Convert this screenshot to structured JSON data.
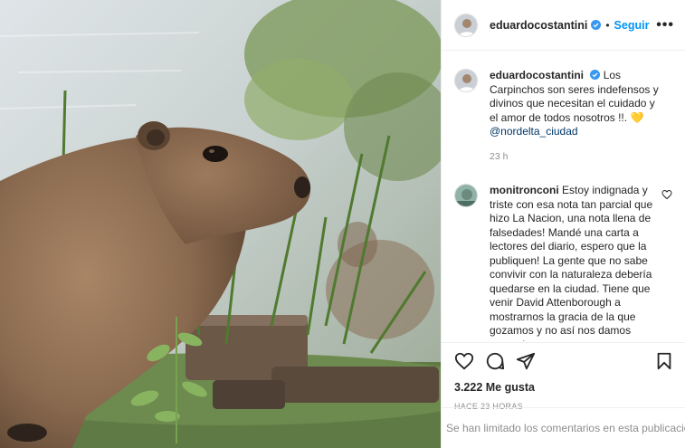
{
  "post": {
    "photo_icon": "capybara-photo",
    "author": {
      "username": "eduardocostantini",
      "verified_icon": "verified-badge-icon",
      "separator": "•",
      "follow_label": "Seguir",
      "more_label": "•••"
    },
    "caption": {
      "username": "eduardocostantini",
      "text": "Los Carpinchos son seres indefensos y divinos que necesitan el cuidado y el amor de todos nosotros !!.",
      "emoji": "💛",
      "mention": "@nordelta_ciudad",
      "time": "23 h"
    },
    "comments": [
      {
        "username": "monitronconi",
        "text": "Estoy indignada y triste con esa nota tan parcial que hizo La Nacion, una nota llena de falsedades! Mandé una carta a lectores del diario, espero que la publiquen! La gente que no sabe convivir con la naturaleza debería quedarse en la ciudad. Tiene que venir David Attenborough a mostrarnos la gracia de la que gozamos y no así nos damos cuenta!"
      }
    ],
    "likes": "3.222 Me gusta",
    "posted_ago": "HACE 23 HORAS",
    "comments_disabled": "Se han limitado los comentarios en esta publicación.",
    "colors": {
      "accent": "#0095f6",
      "muted": "#8e8e8e",
      "link": "#00376b",
      "verified": "#3897f0"
    }
  }
}
